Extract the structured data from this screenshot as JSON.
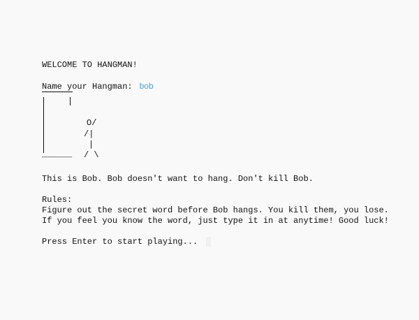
{
  "game": {
    "welcome": "WELCOME TO HANGMAN!",
    "name_prompt": "Name your Hangman:",
    "name_value": "bob",
    "gallows_base": "______",
    "figure": {
      "head_arms": "O/",
      "body_left": "/|",
      "body": "|",
      "legs": "/ \\"
    },
    "intro": "This is Bob. Bob doesn't want to hang. Don't kill Bob.",
    "rules_title": "Rules:",
    "rule_1": "Figure out the secret word before Bob hangs. You kill them, you lose.",
    "rule_2": "If you feel you know the word, just type it in at anytime! Good luck!",
    "start_prompt": "Press Enter to start playing..."
  },
  "colors": {
    "background": "#f9f9f9",
    "text": "#111111",
    "input": "#4aa3df"
  }
}
